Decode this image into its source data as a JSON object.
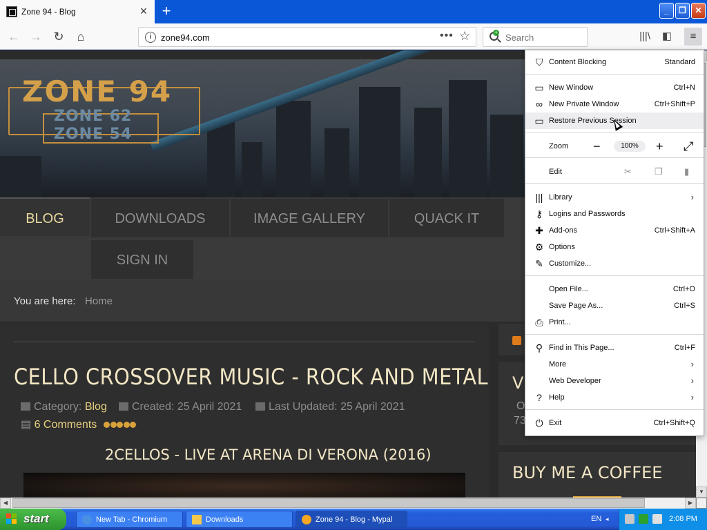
{
  "browser": {
    "tab_title": "Zone 94 - Blog",
    "url": "zone94.com",
    "search_placeholder": "Search"
  },
  "site": {
    "logo_main": "ZONE 94",
    "logo_sub1": "ZONE 62",
    "logo_sub2": "ZONE 54",
    "nav": [
      "BLOG",
      "DOWNLOADS",
      "IMAGE GALLERY",
      "QUACK IT",
      "SIGN IN"
    ],
    "breadcrumb_label": "You are here:",
    "breadcrumb_home": "Home",
    "article": {
      "title": "CELLO CROSSOVER MUSIC - ROCK AND METAL",
      "category_label": "Category:",
      "category_value": "Blog",
      "created": "Created: 25 April 2021",
      "updated": "Last Updated: 25 April 2021",
      "comments": "6 Comments",
      "subtitle": "2CELLOS - LIVE AT ARENA DI VERONA (2016)"
    },
    "sidebar": {
      "vi_text": "VI",
      "o_text": "O",
      "num_text": "73",
      "coffee_title": "BUY ME A COFFEE"
    }
  },
  "menu": {
    "content_blocking": {
      "label": "Content Blocking",
      "value": "Standard"
    },
    "new_window": {
      "label": "New Window",
      "shortcut": "Ctrl+N"
    },
    "private_window": {
      "label": "New Private Window",
      "shortcut": "Ctrl+Shift+P"
    },
    "restore_session": {
      "label": "Restore Previous Session"
    },
    "zoom": {
      "label": "Zoom",
      "level": "100%"
    },
    "edit": {
      "label": "Edit"
    },
    "library": {
      "label": "Library"
    },
    "logins": {
      "label": "Logins and Passwords"
    },
    "addons": {
      "label": "Add-ons",
      "shortcut": "Ctrl+Shift+A"
    },
    "options": {
      "label": "Options"
    },
    "customize": {
      "label": "Customize..."
    },
    "open_file": {
      "label": "Open File...",
      "shortcut": "Ctrl+O"
    },
    "save_page": {
      "label": "Save Page As...",
      "shortcut": "Ctrl+S"
    },
    "print": {
      "label": "Print..."
    },
    "find": {
      "label": "Find in This Page...",
      "shortcut": "Ctrl+F"
    },
    "more": {
      "label": "More"
    },
    "web_developer": {
      "label": "Web Developer"
    },
    "help": {
      "label": "Help"
    },
    "exit": {
      "label": "Exit",
      "shortcut": "Ctrl+Shift+Q"
    }
  },
  "taskbar": {
    "start": "start",
    "tasks": [
      "New Tab - Chromium",
      "Downloads",
      "Zone 94 - Blog - Mypal"
    ],
    "language": "EN",
    "clock": "2:08 PM"
  }
}
